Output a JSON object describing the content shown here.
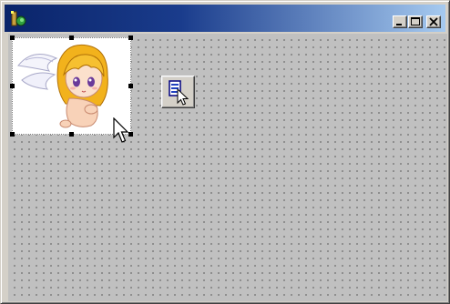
{
  "window": {
    "icon": "app-pen-icon",
    "controls": [
      "minimize-icon",
      "maximize-icon",
      "close-icon"
    ]
  },
  "designer": {
    "grid": true,
    "grid_color": "#606060",
    "background": "#c0c0c0",
    "selected_control": "picture",
    "picture_content": "angel-girl-clipart",
    "toolbox_button_icon": "data-control-pointer-icon"
  },
  "colors": {
    "title_start": "#0a246a",
    "title_end": "#a6caf0",
    "face": "#d4d0c8"
  }
}
